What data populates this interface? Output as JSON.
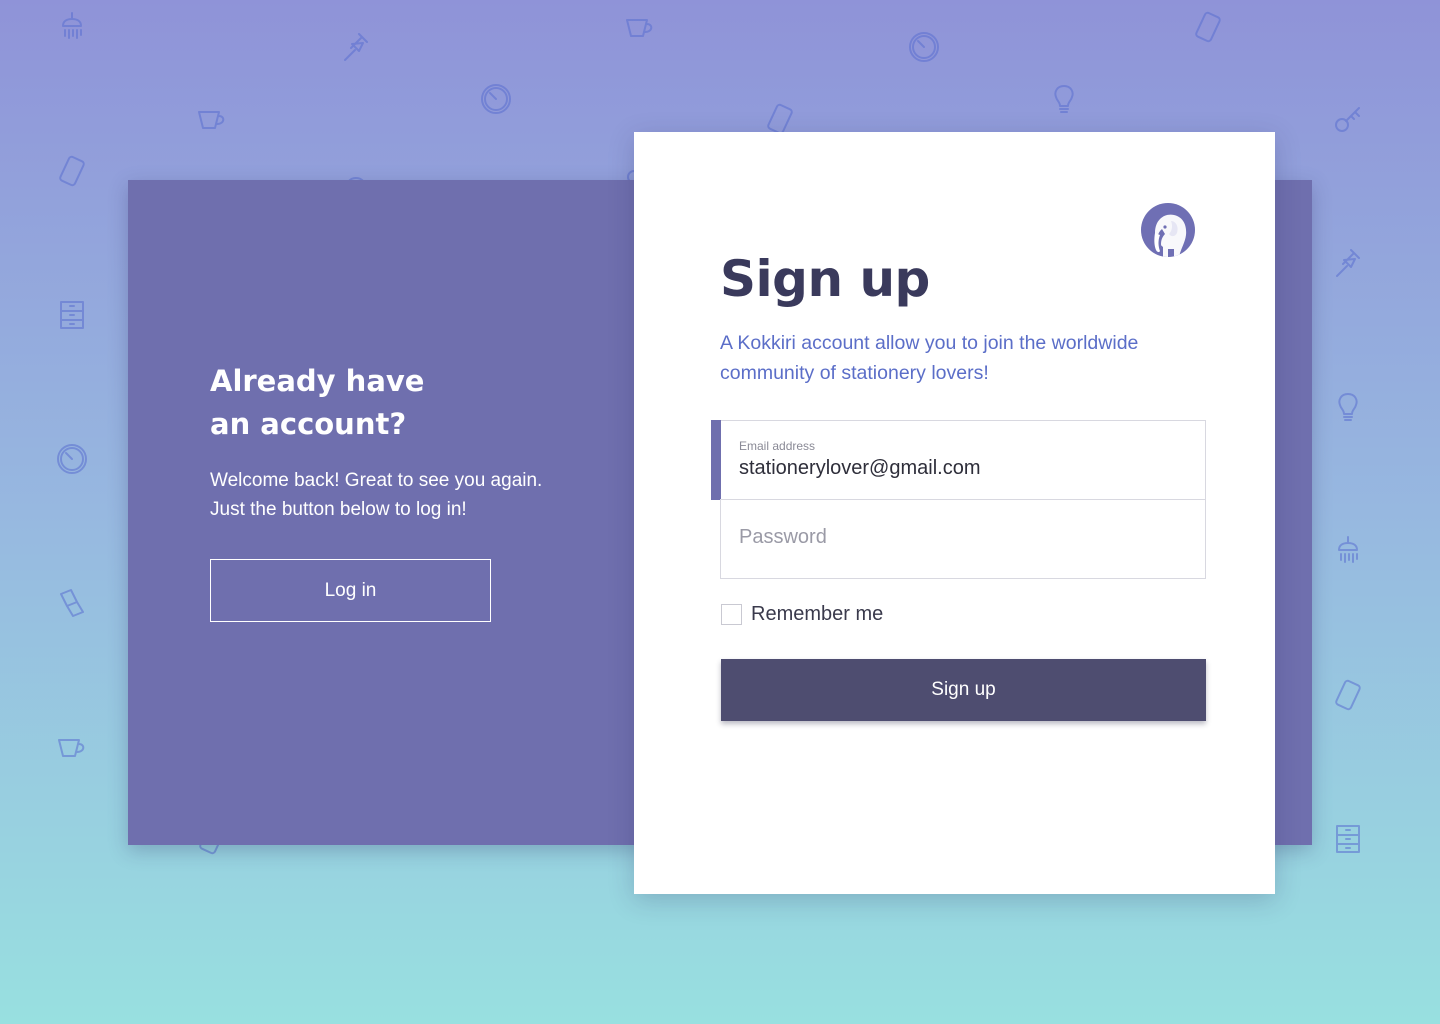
{
  "colors": {
    "background_top": "#8f93d8",
    "background_bottom": "#98e0e0",
    "panel": "#6f6fae",
    "title": "#3a3a5c",
    "subtitle": "#5b6ec8",
    "primary_button": "#4e4d70",
    "pattern_icon": "#5a6fd0"
  },
  "pattern_icons": [
    "shower-icon",
    "garden-tools-icon",
    "teacup-icon",
    "clock-icon",
    "phone-icon",
    "lightbulb-icon",
    "key-icon",
    "chair-icon",
    "drawer-cabinet-icon"
  ],
  "login_panel": {
    "title_line1": "Already have",
    "title_line2": "an account?",
    "text": "Welcome back! Great to see you again.\n Just the button below to log in!",
    "login_button": "Log in"
  },
  "signup_card": {
    "logo_icon": "elephant-icon",
    "title": "Sign up",
    "subtitle": "A Kokkiri account allow you to join the worldwide community of stationery lovers!",
    "email": {
      "label": "Email address",
      "value": "stationerylover@gmail.com"
    },
    "password": {
      "placeholder": "Password"
    },
    "remember_label": "Remember me",
    "remember_checked": false,
    "signup_button": "Sign up"
  }
}
